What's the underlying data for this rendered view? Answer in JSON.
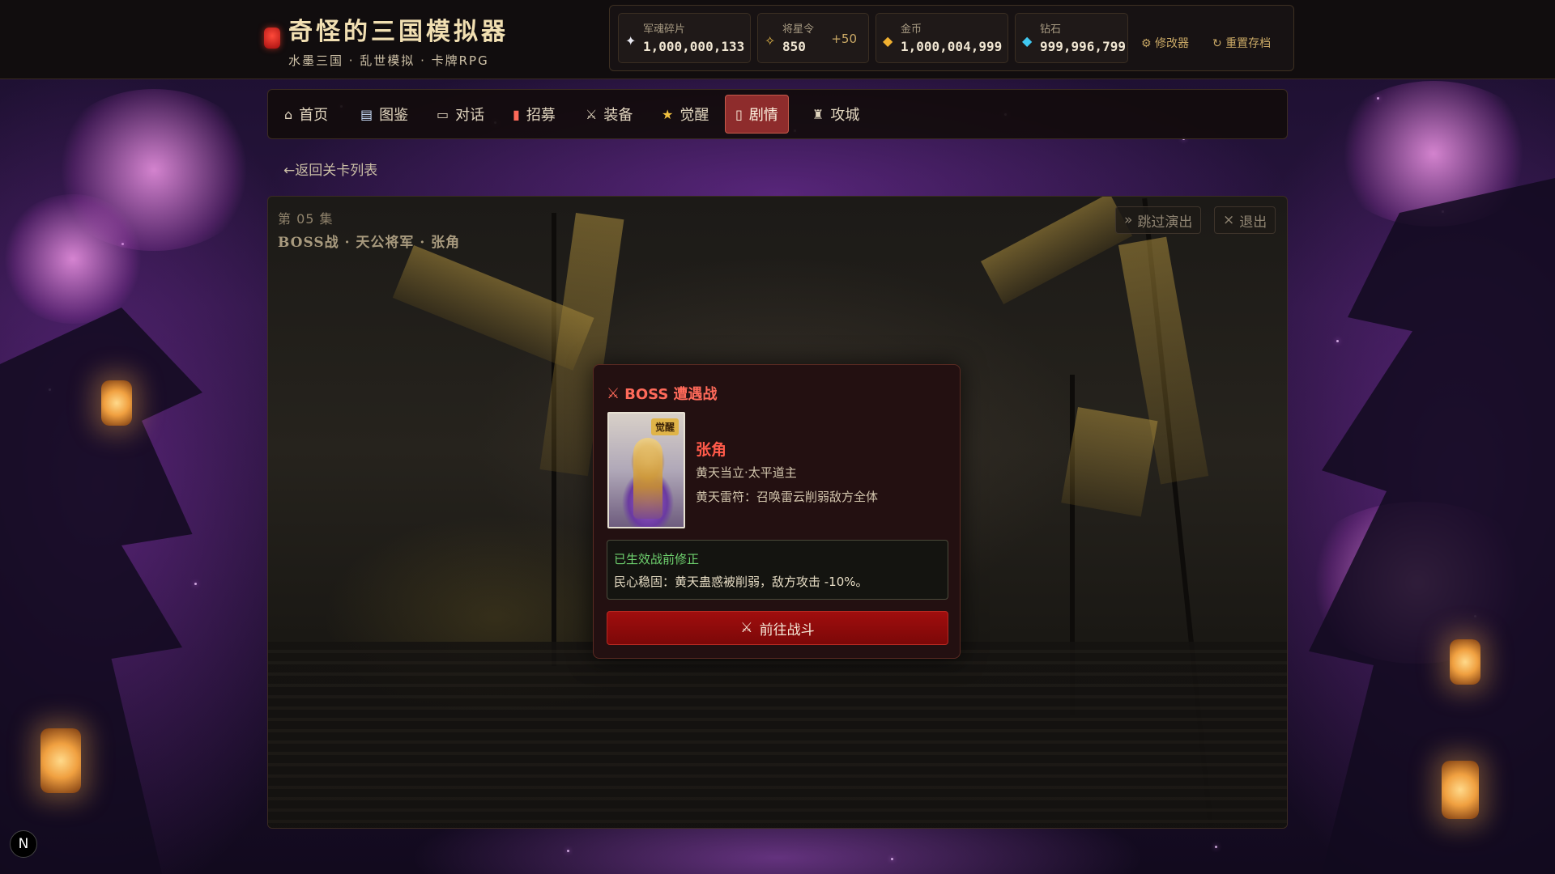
{
  "header": {
    "title": "奇怪的三国模拟器",
    "subtitle": "水墨三国 · 乱世模拟 · 卡牌RPG",
    "resources": [
      {
        "label": "军魂碎片",
        "value": "1,000,000,133",
        "icon": "sparkle-icon"
      },
      {
        "label": "将星令",
        "value": "850",
        "bonus": "+50",
        "icon": "star-token-icon"
      },
      {
        "label": "金币",
        "value": "1,000,004,999",
        "icon": "gold-coin-icon"
      },
      {
        "label": "钻石",
        "value": "999,996,799",
        "icon": "diamond-icon"
      }
    ],
    "modifier_label": "修改器",
    "reset_label": "重置存档"
  },
  "nav": {
    "tabs": [
      {
        "label": "首页",
        "icon": "home-icon"
      },
      {
        "label": "图鉴",
        "icon": "book-icon"
      },
      {
        "label": "对话",
        "icon": "chat-icon"
      },
      {
        "label": "招募",
        "icon": "recruit-icon"
      },
      {
        "label": "装备",
        "icon": "sword-icon"
      },
      {
        "label": "觉醒",
        "icon": "star-icon"
      },
      {
        "label": "剧情",
        "icon": "scroll-icon"
      },
      {
        "label": "攻城",
        "icon": "castle-icon"
      }
    ],
    "active": "剧情"
  },
  "back_label": "返回关卡列表",
  "story": {
    "episode": "第 05 集",
    "title": "BOSS战 · 天公将军 · 张角",
    "skip_label": "跳过演出",
    "exit_label": "退出"
  },
  "boss_modal": {
    "heading": "BOSS 遭遇战",
    "badge": "觉醒",
    "name": "张角",
    "title": "黄天当立·太平道主",
    "skill": "黄天雷符：召唤雷云削弱敌方全体",
    "modifier_title": "已生效战前修正",
    "modifier_text": "民心稳固：黄天蛊惑被削弱，敌方攻击 -10%。",
    "fight_label": "前往战斗"
  },
  "corner_badge": "N",
  "colors": {
    "accent_gold": "#c9a865",
    "active_tab": "#8e2c2c",
    "boss_red": "#ff5a4a",
    "fight_button": "#a00e0e",
    "modifier_green": "#6fd36f"
  }
}
